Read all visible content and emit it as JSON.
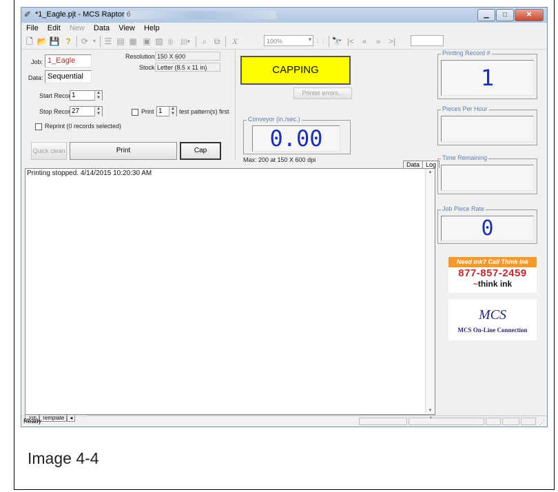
{
  "window": {
    "title": "*1_Eagle.pjt - MCS Raptor 6"
  },
  "menu": {
    "file": "File",
    "edit": "Edit",
    "new": "New",
    "data": "Data",
    "view": "View",
    "help": "Help"
  },
  "toolbar": {
    "zoom_value": "100%"
  },
  "job": {
    "job_label": "Job:",
    "job_value": "1_Eagle",
    "data_label": "Data:",
    "data_value": "Sequential",
    "resolution_label": "Resolution:",
    "resolution_value": "150 X 600",
    "stock_label": "Stock:",
    "stock_value": "Letter (8.5 x 11 in)",
    "start_label": "Start Record:",
    "start_value": "1",
    "stop_label": "Stop Record:",
    "stop_value": "27",
    "print_label": "Print",
    "print_value": "1",
    "test_label": "test pattern(s) first",
    "reprint_label": "Reprint (0 records selected)"
  },
  "buttons": {
    "quick_clean": "Quick clean",
    "print": "Print",
    "cap": "Cap",
    "printer_errors": "Printer errors..."
  },
  "status_banner": {
    "text": "CAPPING",
    "color": "#ffff00"
  },
  "conveyor": {
    "title": "Conveyor (in./sec.)",
    "value": "0.00",
    "max_note": "Max: 200 at 150 X 600 dpi"
  },
  "right_panel": {
    "printing_record_title": "Printing Record #",
    "printing_record_value": "1",
    "pieces_per_hour_title": "Pieces Per Hour",
    "time_remaining_title": "Time Remaining",
    "job_piece_rate_title": "Job Piece Rate",
    "job_piece_rate_value": "0"
  },
  "log_tabs": {
    "data": "Data",
    "log": "Log"
  },
  "log": {
    "line1": "Printing stopped. 4/14/2015 10:20:30 AM"
  },
  "bottom_tabs": {
    "job": "Job",
    "template": "Template"
  },
  "statusbar": {
    "text": "Ready"
  },
  "ads": {
    "thinkink_tagline": "Need ink? Call Think Ink",
    "thinkink_phone": "877-857-2459",
    "thinkink_brand": "think ink",
    "mcs_logo": "MCS",
    "mcs_text": "MCS On-Line Connection"
  },
  "caption": "Image 4-4"
}
